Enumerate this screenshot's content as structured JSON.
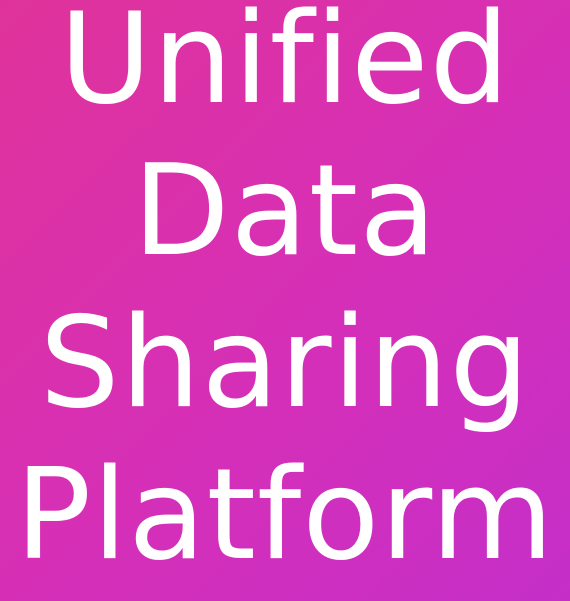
{
  "colors": {
    "background_start": "#e0339a",
    "background_end": "#c52fc8",
    "text": "#ffffff"
  },
  "title": {
    "lines": [
      "Unified",
      "Data",
      "Sharing",
      "Platform"
    ]
  }
}
